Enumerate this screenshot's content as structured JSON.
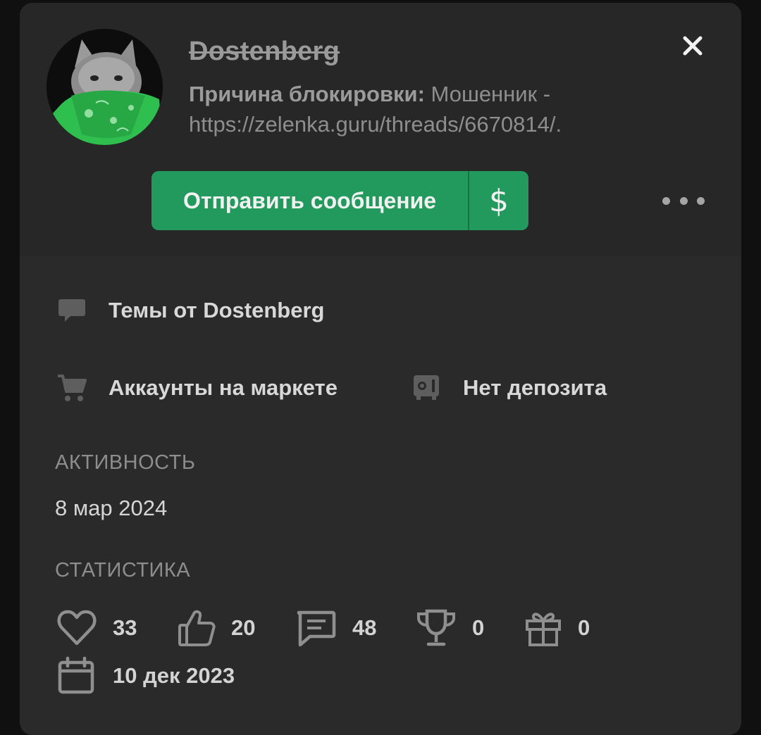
{
  "profile": {
    "username": "Dostenberg",
    "ban_label": "Причина блокировки:",
    "ban_text": "Мошенник - https://zelenka.guru/threads/6670814/."
  },
  "actions": {
    "send_message_label": "Отправить сообщение",
    "money_label": "$"
  },
  "links": {
    "threads_label": "Темы от Dostenberg",
    "market_label": "Аккаунты на маркете",
    "deposit_label": "Нет депозита"
  },
  "activity": {
    "title": "АКТИВНОСТЬ",
    "last_seen": "8 мар 2024"
  },
  "stats": {
    "title": "СТАТИСТИКА",
    "likes": "33",
    "thumbs": "20",
    "messages": "48",
    "trophies": "0",
    "gifts": "0",
    "registered": "10 дек 2023"
  },
  "icons": {
    "close": "close-icon",
    "more": "more-dots-icon",
    "threads": "comment-icon",
    "market": "cart-icon",
    "deposit": "safe-icon",
    "likes": "heart-icon",
    "thumbs": "thumbs-up-icon",
    "messages": "message-icon",
    "trophies": "trophy-icon",
    "gifts": "gift-icon",
    "registered": "calendar-icon"
  },
  "colors": {
    "accent": "#229a5e",
    "card": "#2a2a2a"
  }
}
